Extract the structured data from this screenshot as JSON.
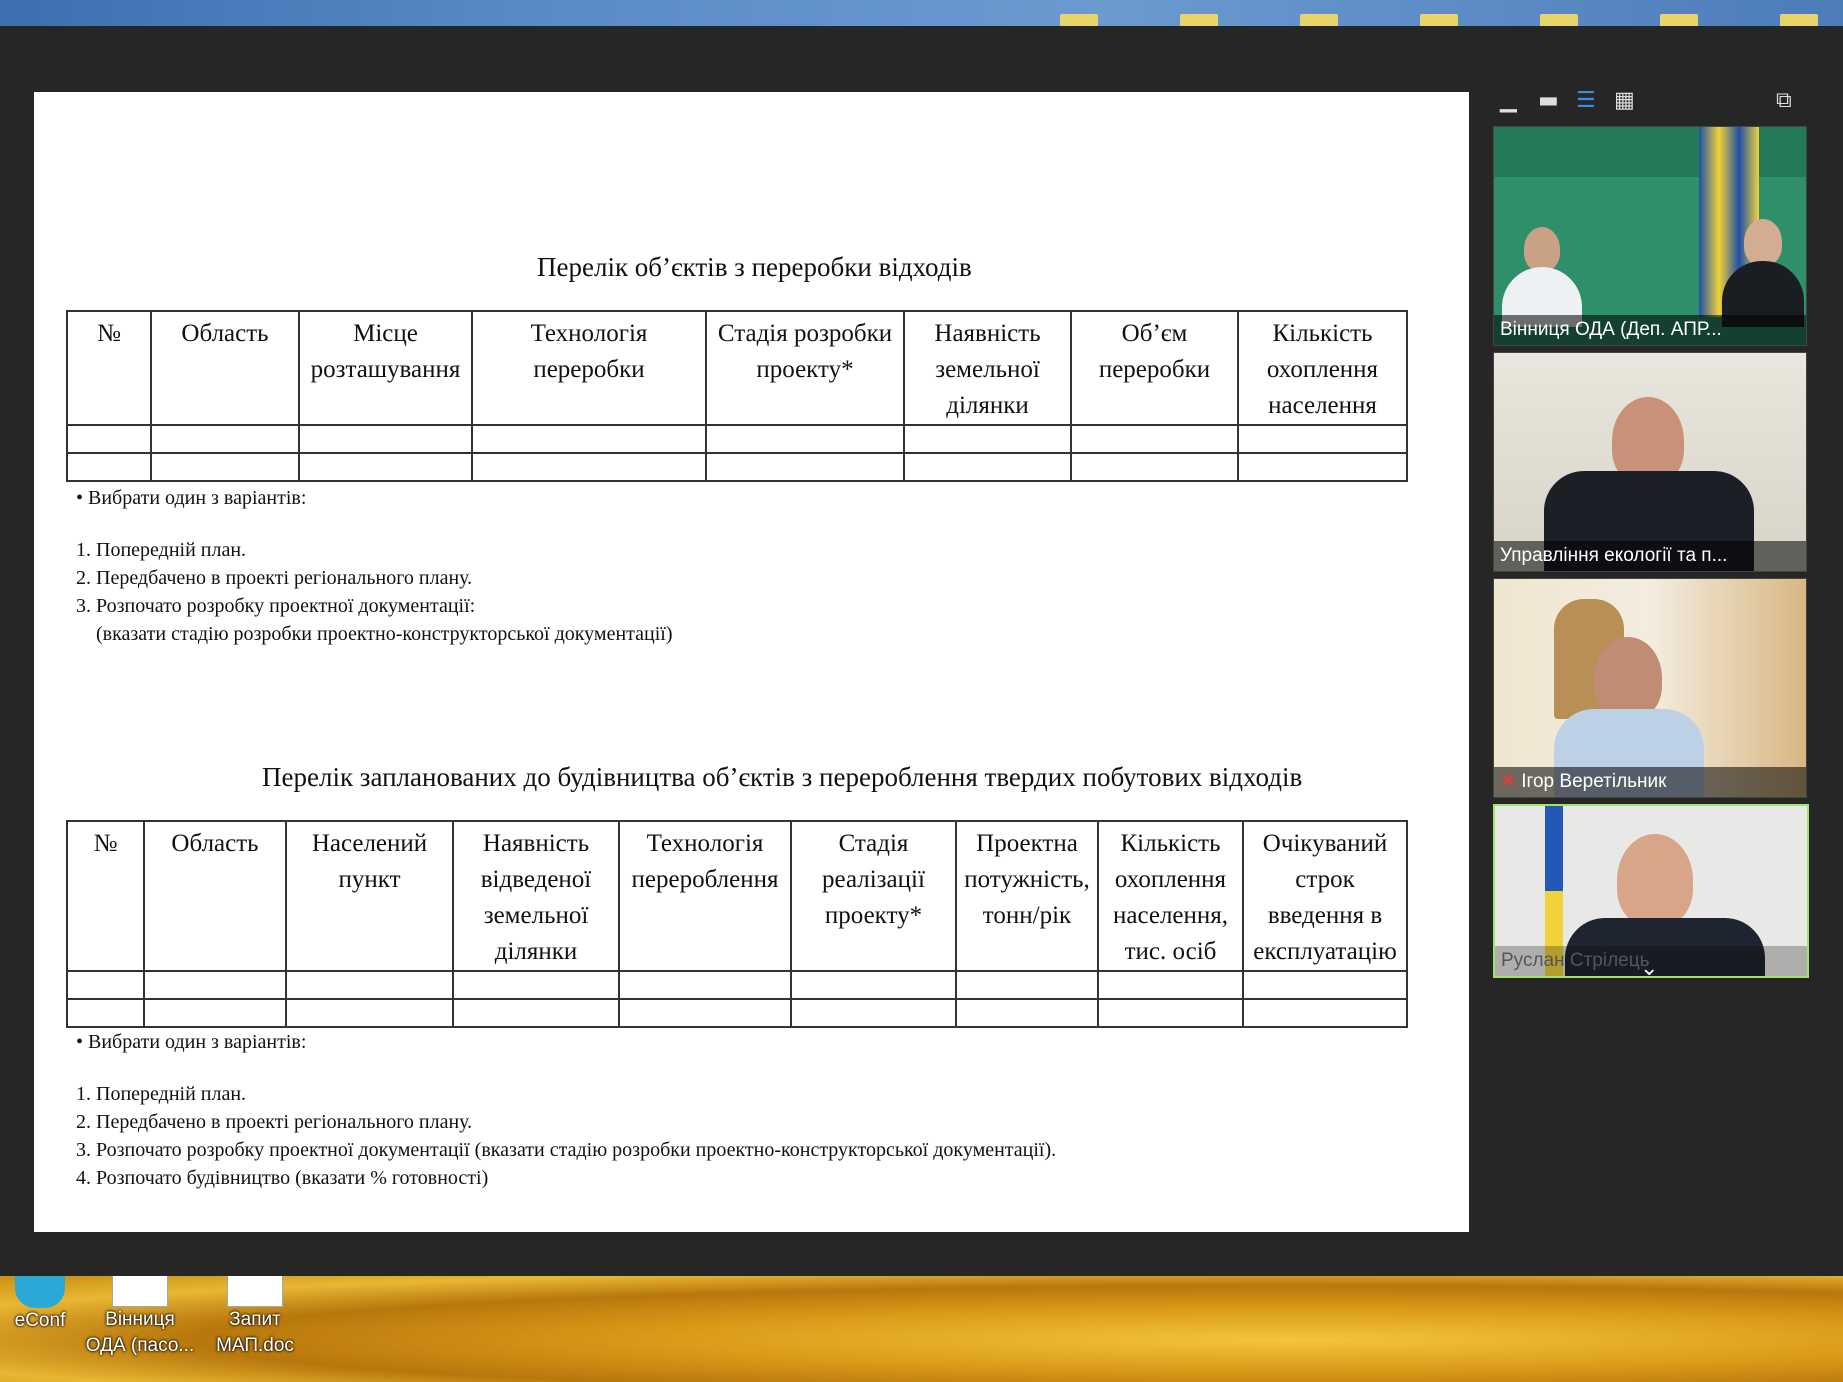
{
  "desktop": {
    "bottom_icons": [
      {
        "label": "eConf"
      },
      {
        "label": "Вінниця ОДА (пасо..."
      },
      {
        "label": "Запит МАП.doc"
      }
    ]
  },
  "document": {
    "table1": {
      "title": "Перелік об’єктів з переробки відходів",
      "headers": [
        "№",
        "Область",
        "Місце розташування",
        "Технологія переробки",
        "Стадія розробки проекту*",
        "Наявність земельної ділянки",
        "Об’єм переробки",
        "Кількість охоплення населення"
      ],
      "note_lines": [
        "• Вибрати один з варіантів:",
        "",
        "1. Попередній план.",
        "2. Передбачено в проекті регіонального плану.",
        "3. Розпочато розробку проектної документації:",
        "   (вказати стадію розробки проектно-конструкторської документації)"
      ]
    },
    "table2": {
      "title": "Перелік запланованих до будівництва об’єктів з перероблення твердих побутових відходів",
      "headers": [
        "№",
        "Область",
        "Населений пункт",
        "Наявність відведеної земельної ділянки",
        "Технологія перероблення",
        "Стадія реалізації проекту*",
        "Проектна потужність, тонн/рік",
        "Кількість охоплення населення, тис. осіб",
        "Очікуваний строк введення в експлуатацію"
      ],
      "note_lines": [
        "• Вибрати один з варіантів:",
        "",
        "1. Попередній план.",
        "2. Передбачено в проекті регіонального плану.",
        "3. Розпочато розробку проектної документації (вказати стадію розробки проектно-конструкторської документації).",
        "4. Розпочато будівництво (вказати % готовності)"
      ]
    }
  },
  "participants": [
    {
      "name": "Вінниця ОДА (Деп. АПР..."
    },
    {
      "name": "Управління екології та п..."
    },
    {
      "name": "Ігор Веретільник",
      "muted": true
    },
    {
      "name": "Руслан Стрілець"
    }
  ],
  "view_controls": {
    "minimize_icon": "minimize-icon",
    "grid_icon": "grid-view-icon",
    "speaker_icon": "speaker-view-icon",
    "gallery_icon": "gallery-view-icon",
    "popout_icon": "popout-icon",
    "chevron_icon": "chevron-down-icon"
  }
}
